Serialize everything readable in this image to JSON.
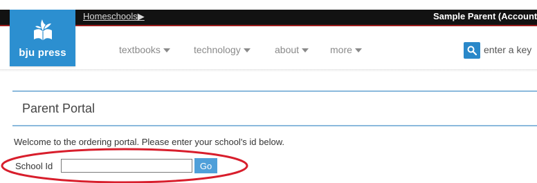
{
  "topbar": {
    "breadcrumb_link": "Homeschools▶",
    "user_label": "Sample Parent (Account"
  },
  "logo": {
    "text": "bju press"
  },
  "nav": {
    "items": [
      {
        "label": "textbooks"
      },
      {
        "label": "technology"
      },
      {
        "label": "about"
      },
      {
        "label": "more"
      }
    ]
  },
  "search": {
    "placeholder": "enter a key"
  },
  "portal": {
    "title": "Parent Portal",
    "welcome_text": "Welcome to the ordering portal. Please enter your school's id below.",
    "school_id_label": "School Id",
    "school_id_value": "",
    "go_label": "Go"
  },
  "colors": {
    "brand_blue": "#2c8fd0",
    "topbar_black": "#121212",
    "topbar_accent_red": "#9b1d1d",
    "portal_border_blue": "#8ab9dc",
    "go_button_blue": "#4f9fd9",
    "annotation_red": "#d81e2c"
  }
}
